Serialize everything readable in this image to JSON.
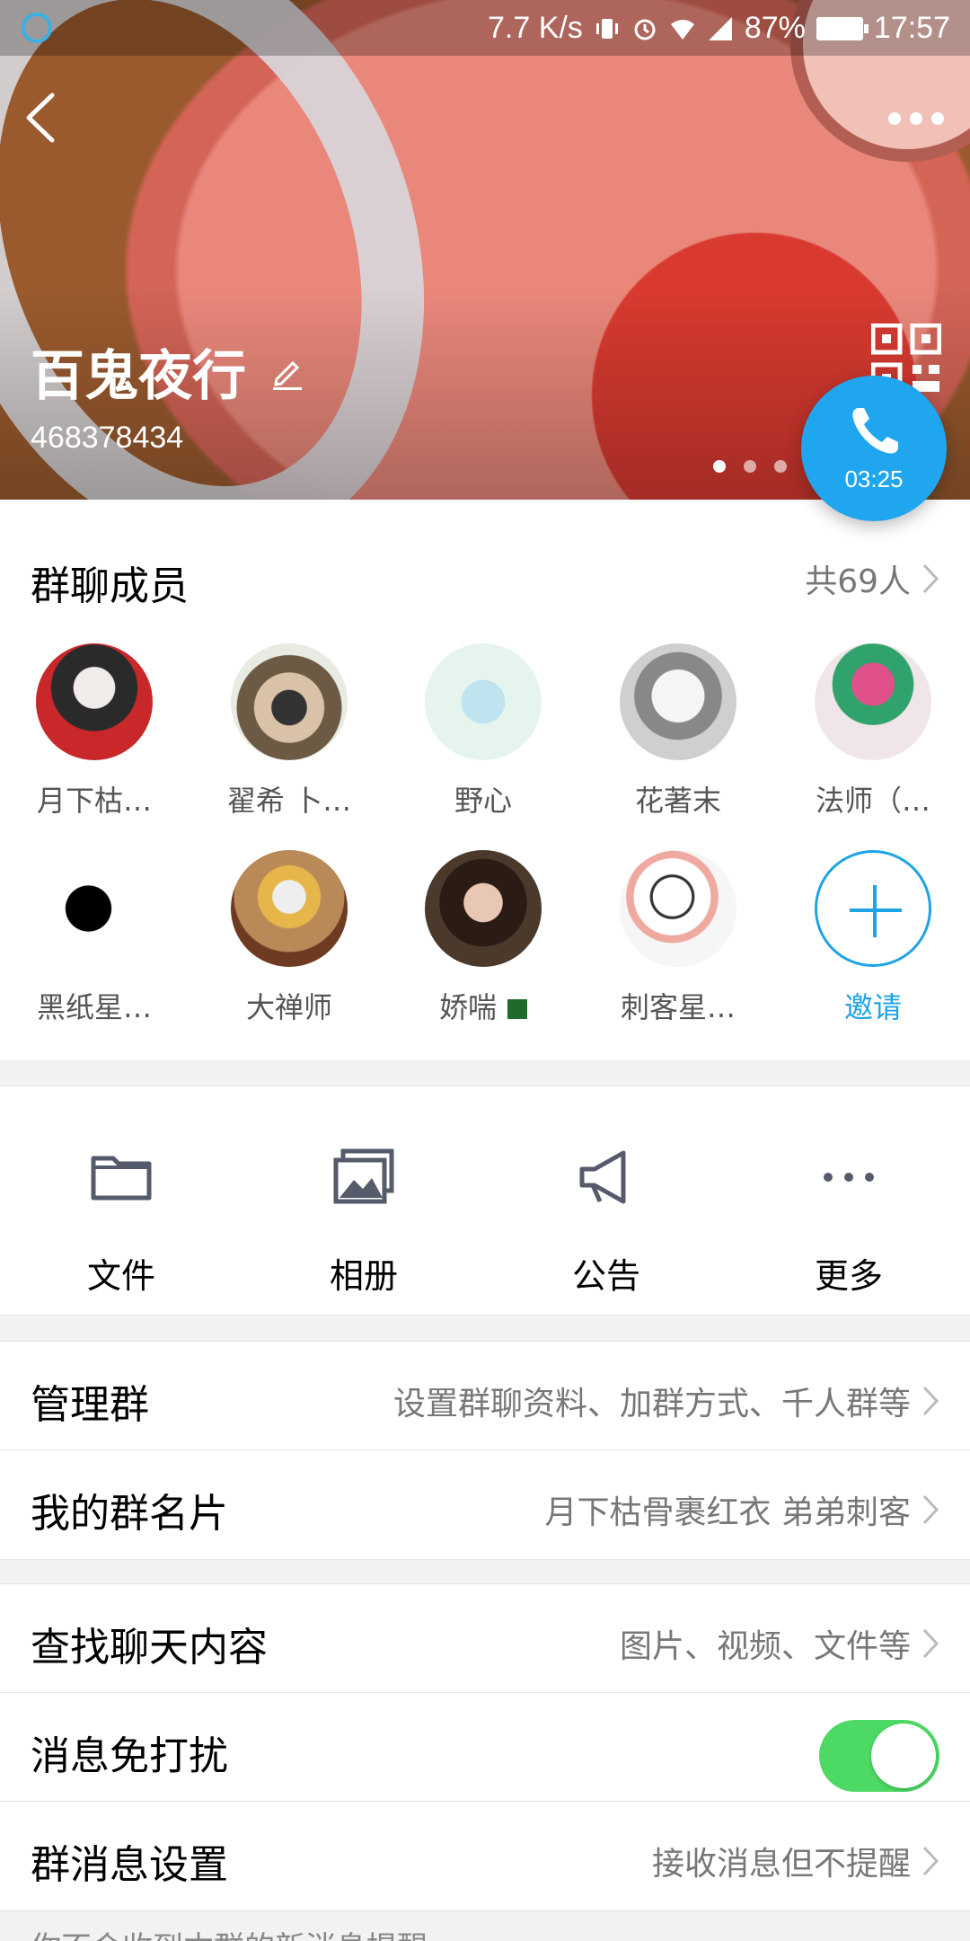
{
  "status_bar": {
    "speed": "7.7 K/s",
    "battery": "87%",
    "time": "17:57"
  },
  "header": {
    "group_name": "百鬼夜行",
    "group_id": "468378434",
    "call_timer": "03:25",
    "page_count": 3,
    "active_page": 1
  },
  "members": {
    "title": "群聊成员",
    "count": "共69人",
    "items": [
      {
        "name": "月下枯…",
        "color": "#c8282a"
      },
      {
        "name": "翟希 卜…",
        "color": "#8a9a7a"
      },
      {
        "name": "野心",
        "color": "#d8efe8"
      },
      {
        "name": "花著末",
        "color": "#cfcfcf"
      },
      {
        "name": "法师（…",
        "color": "#f0e6ea"
      },
      {
        "name": "黑纸星…",
        "color": "#ffffff"
      },
      {
        "name": "大禅师",
        "color": "#b98a58"
      },
      {
        "name": "娇喘",
        "color": "#4b3a2c"
      },
      {
        "name": "刺客星…",
        "color": "#f6f6f6"
      }
    ],
    "invite_label": "邀请"
  },
  "actions": [
    {
      "label": "文件",
      "icon": "folder-icon"
    },
    {
      "label": "相册",
      "icon": "album-icon"
    },
    {
      "label": "公告",
      "icon": "megaphone-icon"
    },
    {
      "label": "更多",
      "icon": "more-dots-icon"
    }
  ],
  "settings": {
    "manage": {
      "label": "管理群",
      "value": "设置群聊资料、加群方式、千人群等"
    },
    "card": {
      "label": "我的群名片",
      "value": "月下枯骨裹红衣 弟弟刺客"
    },
    "search": {
      "label": "查找聊天内容",
      "value": "图片、视频、文件等"
    },
    "dnd": {
      "label": "消息免打扰",
      "on": true
    },
    "msg": {
      "label": "群消息设置",
      "value": "接收消息但不提醒"
    }
  },
  "footer_note": "你不会收到本群的新消息提醒",
  "colors": {
    "accent": "#1ea3e6",
    "toggle_on": "#4cd964"
  }
}
